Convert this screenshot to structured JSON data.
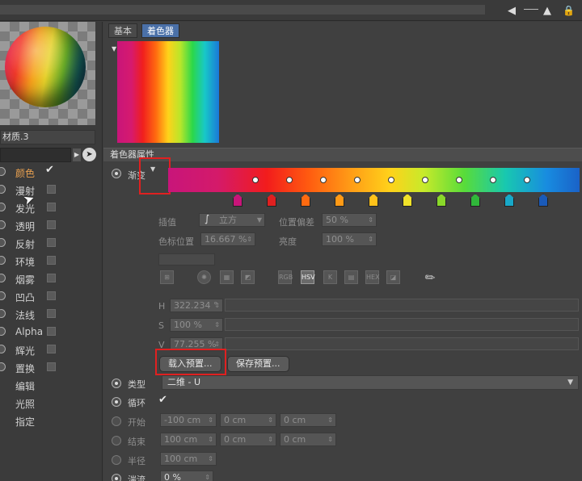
{
  "topbar": {
    "icons": [
      "back-arrow-icon",
      "cursor-arrow-icon",
      "lock-icon"
    ]
  },
  "material": {
    "name": "材质.3"
  },
  "channels": [
    {
      "label": "颜色",
      "checked": true,
      "active": true
    },
    {
      "label": "漫射",
      "checked": false
    },
    {
      "label": "发光",
      "checked": false
    },
    {
      "label": "透明",
      "checked": false
    },
    {
      "label": "反射",
      "checked": false
    },
    {
      "label": "环境",
      "checked": false
    },
    {
      "label": "烟雾",
      "checked": false
    },
    {
      "label": "凹凸",
      "checked": false
    },
    {
      "label": "法线",
      "checked": false
    },
    {
      "label": "Alpha",
      "checked": false
    },
    {
      "label": "辉光",
      "checked": false
    },
    {
      "label": "置换",
      "checked": false
    },
    {
      "label": "编辑"
    },
    {
      "label": "光照"
    },
    {
      "label": "指定"
    }
  ],
  "tabs": [
    {
      "label": "基本",
      "active": false
    },
    {
      "label": "着色器",
      "active": true
    }
  ],
  "section": {
    "title": "着色器属性"
  },
  "gradient": {
    "label": "渐变",
    "flags_colors": [
      "#c8157a",
      "#e02020",
      "#ff6a10",
      "#ff9a16",
      "#ffc21a",
      "#f0e22a",
      "#8ad82a",
      "#30b83a",
      "#18a8c8",
      "#1a5ab8"
    ]
  },
  "knot_props": {
    "interpolation_label": "插值",
    "interpolation_value": "立方",
    "position_offset_label": "位置偏差",
    "position_offset_value": "50 %",
    "color_position_label": "色标位置",
    "color_position_value": "16.667 %",
    "brightness_label": "亮度",
    "brightness_value": "100 %"
  },
  "color_modes": [
    "RGB",
    "HSV",
    "K",
    "HEX"
  ],
  "hsv": {
    "h_label": "H",
    "h_value": "322.234 °",
    "s_label": "S",
    "s_value": "100 %",
    "v_label": "V",
    "v_value": "77.255 %"
  },
  "buttons": {
    "load_preset": "载入预置...",
    "save_preset": "保存预置..."
  },
  "params": {
    "type_label": "类型",
    "type_value": "二维 - U",
    "loop_label": "循环",
    "start_label": "开始",
    "start_values": [
      "-100 cm",
      "0 cm",
      "0 cm"
    ],
    "end_label": "结束",
    "end_values": [
      "100 cm",
      "0 cm",
      "0 cm"
    ],
    "radius_label": "半径",
    "radius_value": "100 cm",
    "turbulence_label": "湍流",
    "turbulence_value": "0 %"
  }
}
